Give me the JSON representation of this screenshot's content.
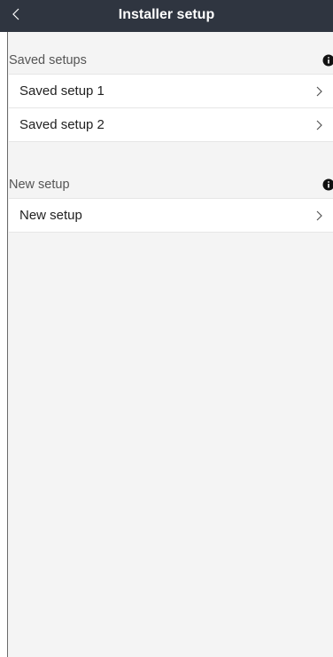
{
  "nav": {
    "title": "Installer setup",
    "back_icon": "chevron-left-icon"
  },
  "sections": {
    "saved": {
      "header": "Saved setups",
      "info_icon": "info-icon",
      "items": [
        {
          "label": "Saved setup 1",
          "icon": "chevron-right-icon"
        },
        {
          "label": "Saved setup 2",
          "icon": "chevron-right-icon"
        }
      ]
    },
    "new": {
      "header": "New setup",
      "info_icon": "info-icon",
      "items": [
        {
          "label": "New setup",
          "icon": "chevron-right-icon"
        }
      ]
    }
  },
  "colors": {
    "nav_background": "#2f3540",
    "page_background": "#f4f4f4",
    "row_background": "#ffffff",
    "divider": "#e6e6e6"
  }
}
